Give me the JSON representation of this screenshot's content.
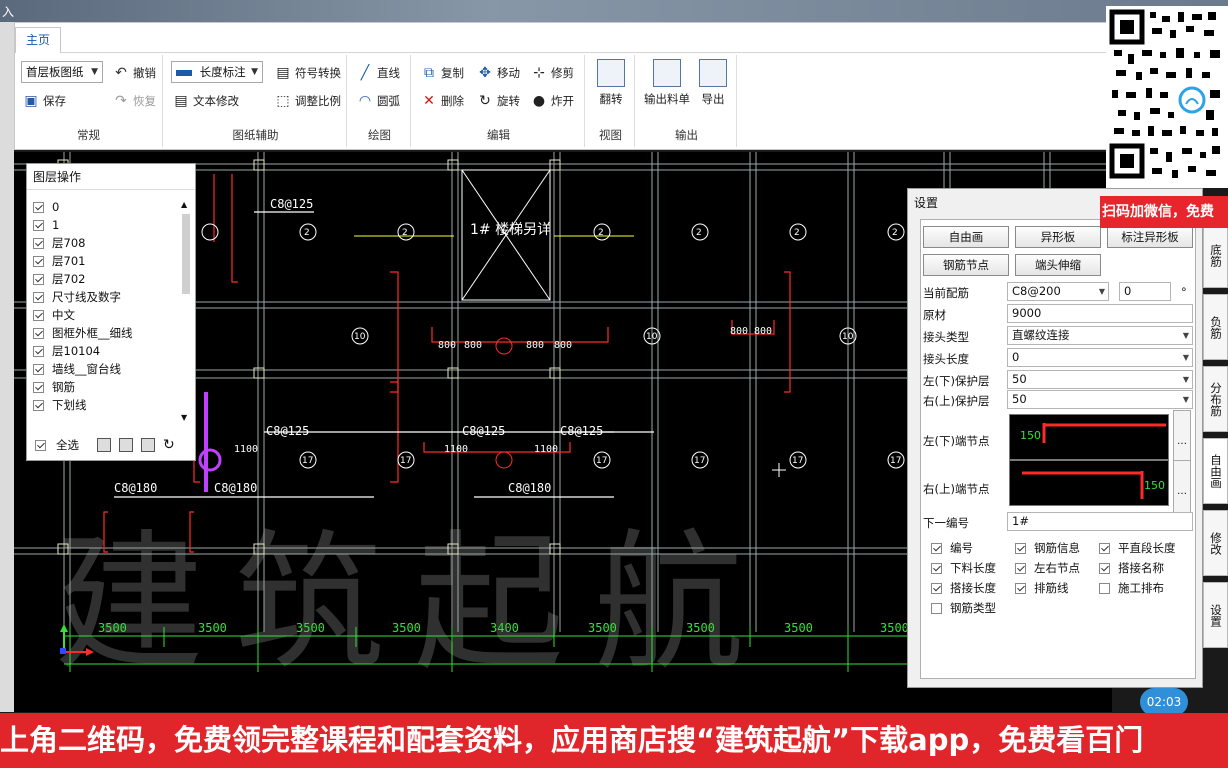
{
  "title_strip": {
    "text": "入"
  },
  "ribbon": {
    "tab": "主页",
    "panels": {
      "changgui": {
        "label": "常规",
        "drawing_combo": "首层板图纸",
        "undo": "撤销",
        "save": "保存",
        "redo": "恢复"
      },
      "tuzhi": {
        "label": "图纸辅助",
        "dim_combo": "长度标注",
        "symbol_convert": "符号转换",
        "text_edit": "文本修改",
        "adjust_scale": "调整比例"
      },
      "draw": {
        "label": "绘图",
        "line": "直线",
        "arc": "圆弧"
      },
      "edit": {
        "label": "编辑",
        "copy": "复制",
        "move": "移动",
        "trim": "修剪",
        "delete": "删除",
        "rotate": "旋转",
        "explode": "炸开"
      },
      "view": {
        "label": "视图",
        "flip": "翻转"
      },
      "output": {
        "label": "输出",
        "export_list": "输出料单",
        "export": "导出"
      }
    }
  },
  "layer_panel": {
    "title": "图层操作",
    "layers": [
      {
        "name": "0",
        "checked": true
      },
      {
        "name": "1",
        "checked": true
      },
      {
        "name": "层708",
        "checked": true
      },
      {
        "name": "层701",
        "checked": true
      },
      {
        "name": "层702",
        "checked": true
      },
      {
        "name": "尺寸线及数字",
        "checked": true
      },
      {
        "name": "中文",
        "checked": true
      },
      {
        "name": "图框外框__细线",
        "checked": true
      },
      {
        "name": "层10104",
        "checked": true
      },
      {
        "name": "墙线__窗台线",
        "checked": true
      },
      {
        "name": "钢筋",
        "checked": true
      },
      {
        "name": "下划线",
        "checked": true
      }
    ],
    "select_all": "全选"
  },
  "cad": {
    "stair_note": "1# 楼梯另详",
    "rebar_labels": [
      "C8@125",
      "C8@125",
      "C8@125",
      "C8@180",
      "C8@180",
      "C8@180",
      "C8@125"
    ],
    "dims_bottom": [
      "3500",
      "3500",
      "3500",
      "3500",
      "3400",
      "3500",
      "3500",
      "3500",
      "3500"
    ],
    "watermark": "建筑起航",
    "lengths": [
      "800",
      "800",
      "800",
      "800",
      "800",
      "800",
      "1100",
      "1100",
      "1100",
      "300",
      "300",
      "1200"
    ],
    "circle_tags": [
      "2",
      "2",
      "2",
      "2",
      "2",
      "10",
      "10",
      "10",
      "15",
      "15",
      "17",
      "17",
      "17",
      "17",
      "17",
      "17",
      "18"
    ]
  },
  "settings": {
    "title": "设置",
    "buttons": [
      "自由画",
      "异形板",
      "标注异形板",
      "钢筋节点",
      "端头伸缩"
    ],
    "current_rebar": {
      "label": "当前配筋",
      "value": "C8@200",
      "angle": "0",
      "unit": "°"
    },
    "raw": {
      "label": "原材",
      "value": "9000"
    },
    "joint_type": {
      "label": "接头类型",
      "value": "直螺纹连接"
    },
    "joint_length": {
      "label": "接头长度",
      "value": "0"
    },
    "cover_left": {
      "label": "左(下)保护层",
      "value": "50"
    },
    "cover_right": {
      "label": "右(上)保护层",
      "value": "50"
    },
    "node_left": {
      "label": "左(下)端节点",
      "value": "150"
    },
    "node_right": {
      "label": "右(上)端节点",
      "value": "150"
    },
    "next_no": {
      "label": "下一编号",
      "value": "1#"
    },
    "checks": [
      {
        "label": "编号",
        "checked": true
      },
      {
        "label": "钢筋信息",
        "checked": true
      },
      {
        "label": "平直段长度",
        "checked": true
      },
      {
        "label": "下料长度",
        "checked": true
      },
      {
        "label": "左右节点",
        "checked": true
      },
      {
        "label": "搭接名称",
        "checked": true
      },
      {
        "label": "搭接长度",
        "checked": true
      },
      {
        "label": "排筋线",
        "checked": true
      },
      {
        "label": "施工排布",
        "checked": false
      },
      {
        "label": "钢筋类型",
        "checked": false
      }
    ],
    "side_tabs": [
      "底筋",
      "负筋",
      "分布筋",
      "自由画",
      "修改",
      "设置"
    ]
  },
  "promo": {
    "qr_text": "扫码加微信，免费",
    "banner": "上角二维码，免费领完整课程和配套资料，应用商店搜“建筑起航”下载app，免费看百门",
    "time": "02:03"
  },
  "colors": {
    "grid": "#9aa8a8",
    "rebar": "#ff2a2a",
    "dim": "#36e036",
    "text": "#ffffff",
    "purple": "#c040ff",
    "yellow": "#ffff30"
  }
}
